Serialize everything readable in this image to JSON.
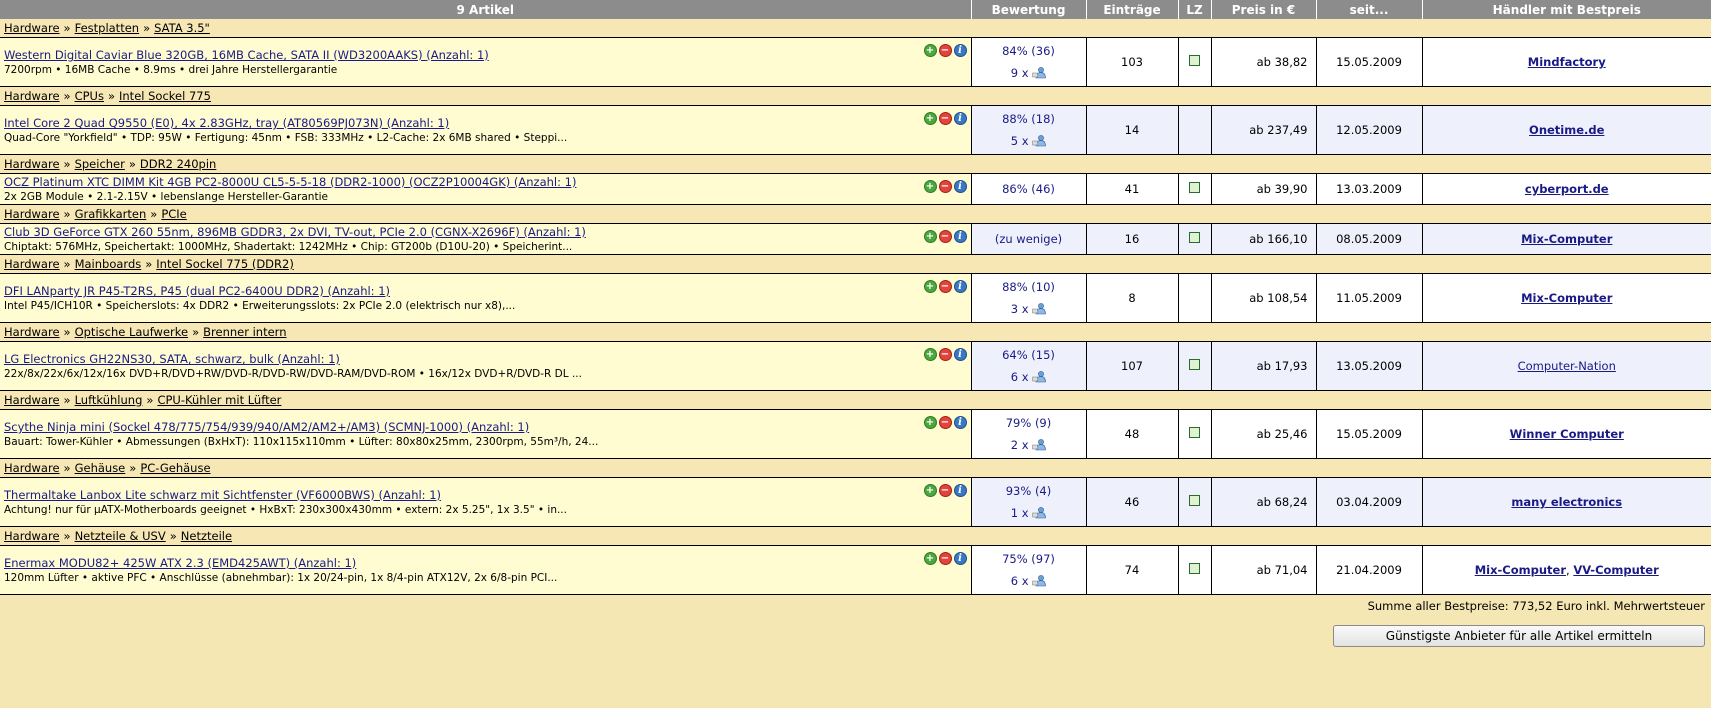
{
  "header": {
    "articles": "9 Artikel",
    "rating": "Bewertung",
    "entries": "Einträge",
    "lz": "LZ",
    "price": "Preis in €",
    "since": "seit...",
    "dealer": "Händler mit Bestpreis"
  },
  "items": [
    {
      "crumbs": [
        "Hardware",
        "Festplatten",
        "SATA 3.5\""
      ],
      "title": "Western Digital Caviar Blue 320GB, 16MB Cache, SATA II (WD3200AAKS) (Anzahl: 1)",
      "desc": "7200rpm • 16MB Cache • 8.9ms • drei Jahre Herstellergarantie",
      "rating": "84% (36)",
      "votes": "9 x",
      "entries": "103",
      "lz": true,
      "price": "ab 38,82",
      "since": "15.05.2009",
      "dealers": [
        "Mindfactory"
      ],
      "bold": true
    },
    {
      "crumbs": [
        "Hardware",
        "CPUs",
        "Intel Sockel 775"
      ],
      "title": "Intel Core 2 Quad Q9550 (E0), 4x 2.83GHz, tray (AT80569PJ073N) (Anzahl: 1)",
      "desc": "Quad-Core \"Yorkfield\" • TDP: 95W • Fertigung: 45nm • FSB: 333MHz • L2-Cache: 2x 6MB shared • Steppi...",
      "rating": "88% (18)",
      "votes": "5 x",
      "entries": "14",
      "lz": false,
      "price": "ab 237,49",
      "since": "12.05.2009",
      "dealers": [
        "Onetime.de"
      ],
      "bold": true
    },
    {
      "crumbs": [
        "Hardware",
        "Speicher",
        "DDR2 240pin"
      ],
      "title": "OCZ Platinum XTC DIMM Kit 4GB PC2-8000U CL5-5-5-18 (DDR2-1000) (OCZ2P10004GK) (Anzahl: 1)",
      "desc": "2x 2GB Module • 2.1-2.15V • lebenslange Hersteller-Garantie",
      "rating": "86% (46)",
      "votes": "",
      "entries": "41",
      "lz": true,
      "price": "ab 39,90",
      "since": "13.03.2009",
      "dealers": [
        "cyberport.de"
      ],
      "bold": true
    },
    {
      "crumbs": [
        "Hardware",
        "Grafikkarten",
        "PCIe"
      ],
      "title": "Club 3D GeForce GTX 260 55nm, 896MB GDDR3, 2x DVI, TV-out, PCIe 2.0 (CGNX-X2696F) (Anzahl: 1)",
      "desc": "Chiptakt: 576MHz, Speichertakt: 1000MHz, Shadertakt: 1242MHz • Chip: GT200b (D10U-20) • Speicherint...",
      "rating": "(zu wenige)",
      "votes": "",
      "entries": "16",
      "lz": true,
      "price": "ab 166,10",
      "since": "08.05.2009",
      "dealers": [
        "Mix-Computer"
      ],
      "bold": true
    },
    {
      "crumbs": [
        "Hardware",
        "Mainboards",
        "Intel Sockel 775 (DDR2)"
      ],
      "title": "DFI LANparty JR P45-T2RS, P45 (dual PC2-6400U DDR2) (Anzahl: 1)",
      "desc": "Intel P45/ICH10R • Speicherslots: 4x DDR2 • Erweiterungsslots: 2x PCIe 2.0 (elektrisch nur x8),...",
      "rating": "88% (10)",
      "votes": "3 x",
      "entries": "8",
      "lz": false,
      "price": "ab 108,54",
      "since": "11.05.2009",
      "dealers": [
        "Mix-Computer"
      ],
      "bold": true
    },
    {
      "crumbs": [
        "Hardware",
        "Optische Laufwerke",
        "Brenner intern"
      ],
      "title": "LG Electronics GH22NS30, SATA, schwarz, bulk (Anzahl: 1)",
      "desc": "22x/8x/22x/6x/12x/16x DVD+R/DVD+RW/DVD-R/DVD-RW/DVD-RAM/DVD-ROM • 16x/12x DVD+R/DVD-R DL ...",
      "rating": "64% (15)",
      "votes": "6 x",
      "entries": "107",
      "lz": true,
      "price": "ab 17,93",
      "since": "13.05.2009",
      "dealers": [
        "Computer-Nation"
      ],
      "bold": false
    },
    {
      "crumbs": [
        "Hardware",
        "Luftkühlung",
        "CPU-Kühler mit Lüfter"
      ],
      "title": "Scythe Ninja mini (Sockel 478/775/754/939/940/AM2/AM2+/AM3) (SCMNJ-1000) (Anzahl: 1)",
      "desc": "Bauart: Tower-Kühler • Abmessungen (BxHxT): 110x115x110mm • Lüfter: 80x80x25mm, 2300rpm, 55m³/h, 24...",
      "rating": "79% (9)",
      "votes": "2 x",
      "entries": "48",
      "lz": true,
      "price": "ab 25,46",
      "since": "15.05.2009",
      "dealers": [
        "Winner Computer"
      ],
      "bold": true
    },
    {
      "crumbs": [
        "Hardware",
        "Gehäuse",
        "PC-Gehäuse"
      ],
      "title": "Thermaltake Lanbox Lite schwarz mit Sichtfenster (VF6000BWS) (Anzahl: 1)",
      "desc": "Achtung! nur für µATX-Motherboards geeignet • HxBxT: 230x300x430mm • extern: 2x 5.25\", 1x 3.5\" • in...",
      "rating": "93% (4)",
      "votes": "1 x",
      "entries": "46",
      "lz": true,
      "price": "ab 68,24",
      "since": "03.04.2009",
      "dealers": [
        "many electronics"
      ],
      "bold": true
    },
    {
      "crumbs": [
        "Hardware",
        "Netzteile & USV",
        "Netzteile"
      ],
      "title": "Enermax MODU82+ 425W ATX 2.3 (EMD425AWT) (Anzahl: 1)",
      "desc": "120mm Lüfter • aktive PFC • Anschlüsse (abnehmbar): 1x 20/24-pin, 1x 8/4-pin ATX12V, 2x 6/8-pin PCI...",
      "rating": "75% (97)",
      "votes": "6 x",
      "entries": "74",
      "lz": true,
      "price": "ab 71,04",
      "since": "21.04.2009",
      "dealers": [
        "Mix-Computer",
        "VV-Computer"
      ],
      "bold": true
    }
  ],
  "summary": "Summe aller Bestpreise: 773,52 Euro inkl. Mehrwertsteuer",
  "button_label": "Günstigste Anbieter für alle Artikel ermitteln",
  "crumb_separator": "»",
  "dealer_separator": ", "
}
